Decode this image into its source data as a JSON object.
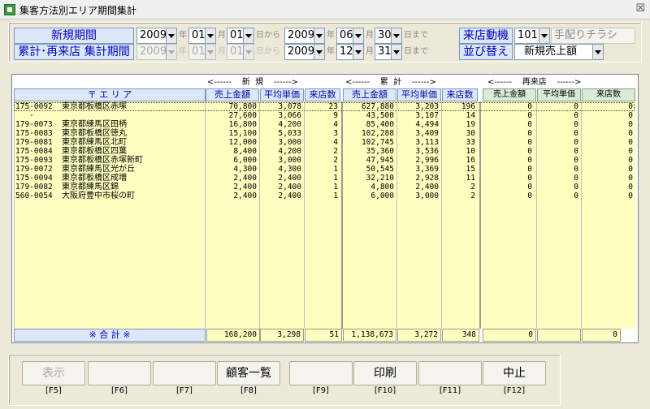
{
  "window": {
    "title": "集客方法別エリア期間集計"
  },
  "filter": {
    "new_period_label": "新規期間",
    "cumulative_period_label": "累計･再来店 集計期間",
    "new_from": {
      "year": "2009",
      "month": "01",
      "day": "01"
    },
    "new_to": {
      "year": "2009",
      "month": "06",
      "day": "30"
    },
    "cum_from": {
      "year": "2009",
      "month": "01",
      "day": "01"
    },
    "cum_to": {
      "year": "2009",
      "month": "12",
      "day": "31"
    },
    "units": {
      "year": "年",
      "month": "月",
      "day_from": "日から",
      "day_to": "日まで"
    },
    "visit_motive_label": "来店動機",
    "visit_motive_code": "101",
    "visit_motive_name": "手配りチラシ",
    "sort_label": "並び替え",
    "sort_value": "新規売上額"
  },
  "grid": {
    "group_new": "<------    新  規    ------>",
    "group_cum": "<------    累  計    ------>",
    "group_revisit": "<------    再来店    ------>",
    "area_header": "〒 エ リ ア",
    "columns": [
      "売上金額",
      "平均単価",
      "来店数",
      "売上金額",
      "平均単価",
      "来店数",
      "売上金額",
      "平均単価",
      "来店数"
    ],
    "rows": [
      {
        "zip": "175-0092",
        "area": "東京都板橋区赤塚",
        "v": [
          "70,800",
          "3,078",
          "23",
          "627,880",
          "3,203",
          "196",
          "0",
          "0",
          "0"
        ]
      },
      {
        "zip": "   -",
        "area": "",
        "v": [
          "27,600",
          "3,066",
          "9",
          "43,500",
          "3,107",
          "14",
          "0",
          "0",
          "0"
        ]
      },
      {
        "zip": "179-0073",
        "area": "東京都練馬区田柄",
        "v": [
          "16,800",
          "4,200",
          "4",
          "85,400",
          "4,494",
          "19",
          "0",
          "0",
          "0"
        ]
      },
      {
        "zip": "175-0083",
        "area": "東京都板橋区徳丸",
        "v": [
          "15,100",
          "5,033",
          "3",
          "102,288",
          "3,409",
          "30",
          "0",
          "0",
          "0"
        ]
      },
      {
        "zip": "179-0081",
        "area": "東京都練馬区北町",
        "v": [
          "12,000",
          "3,000",
          "4",
          "102,745",
          "3,113",
          "33",
          "0",
          "0",
          "0"
        ]
      },
      {
        "zip": "175-0084",
        "area": "東京都板橋区四葉",
        "v": [
          "8,400",
          "4,200",
          "2",
          "35,360",
          "3,536",
          "10",
          "0",
          "0",
          "0"
        ]
      },
      {
        "zip": "175-0093",
        "area": "東京都板橋区赤塚新町",
        "v": [
          "6,000",
          "3,000",
          "2",
          "47,945",
          "2,996",
          "16",
          "0",
          "0",
          "0"
        ]
      },
      {
        "zip": "179-0072",
        "area": "東京都練馬区光が丘",
        "v": [
          "4,300",
          "4,300",
          "1",
          "50,545",
          "3,369",
          "15",
          "0",
          "0",
          "0"
        ]
      },
      {
        "zip": "175-0094",
        "area": "東京都板橋区成増",
        "v": [
          "2,400",
          "2,400",
          "1",
          "32,210",
          "2,928",
          "11",
          "0",
          "0",
          "0"
        ]
      },
      {
        "zip": "179-0082",
        "area": "東京都練馬区錦",
        "v": [
          "2,400",
          "2,400",
          "1",
          "4,800",
          "2,400",
          "2",
          "0",
          "0",
          "0"
        ]
      },
      {
        "zip": "560-0054",
        "area": "大阪府豊中市桜の町",
        "v": [
          "2,400",
          "2,400",
          "1",
          "6,000",
          "3,000",
          "2",
          "0",
          "0",
          "0"
        ]
      }
    ],
    "total_label": "※ 合 計 ※",
    "totals": [
      "168,200",
      "3,298",
      "51",
      "1,138,673",
      "3,272",
      "348",
      "0",
      "",
      "0"
    ]
  },
  "fkeys": [
    {
      "label": "表示",
      "key": "[F5]",
      "enabled": false
    },
    {
      "label": "",
      "key": "[F6]",
      "enabled": false
    },
    {
      "label": "",
      "key": "[F7]",
      "enabled": false
    },
    {
      "label": "顧客一覧",
      "key": "[F8]",
      "enabled": true
    },
    {
      "label": "",
      "key": "[F9]",
      "enabled": false
    },
    {
      "label": "印刷",
      "key": "[F10]",
      "enabled": true
    },
    {
      "label": "",
      "key": "[F11]",
      "enabled": false
    },
    {
      "label": "中止",
      "key": "[F12]",
      "enabled": true
    }
  ]
}
